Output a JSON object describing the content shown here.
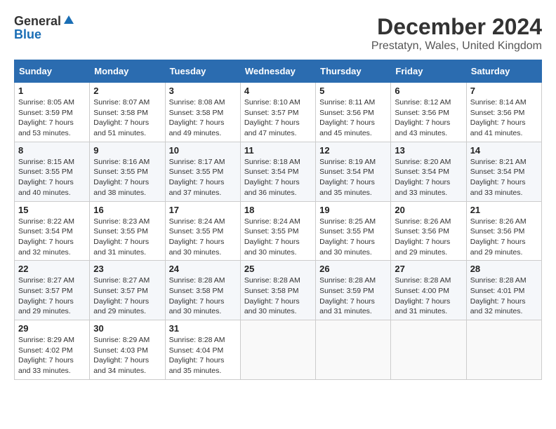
{
  "header": {
    "logo_general": "General",
    "logo_blue": "Blue",
    "month_title": "December 2024",
    "location": "Prestatyn, Wales, United Kingdom"
  },
  "days_of_week": [
    "Sunday",
    "Monday",
    "Tuesday",
    "Wednesday",
    "Thursday",
    "Friday",
    "Saturday"
  ],
  "weeks": [
    [
      {
        "day": "1",
        "sunrise": "8:05 AM",
        "sunset": "3:59 PM",
        "daylight": "7 hours and 53 minutes."
      },
      {
        "day": "2",
        "sunrise": "8:07 AM",
        "sunset": "3:58 PM",
        "daylight": "7 hours and 51 minutes."
      },
      {
        "day": "3",
        "sunrise": "8:08 AM",
        "sunset": "3:58 PM",
        "daylight": "7 hours and 49 minutes."
      },
      {
        "day": "4",
        "sunrise": "8:10 AM",
        "sunset": "3:57 PM",
        "daylight": "7 hours and 47 minutes."
      },
      {
        "day": "5",
        "sunrise": "8:11 AM",
        "sunset": "3:56 PM",
        "daylight": "7 hours and 45 minutes."
      },
      {
        "day": "6",
        "sunrise": "8:12 AM",
        "sunset": "3:56 PM",
        "daylight": "7 hours and 43 minutes."
      },
      {
        "day": "7",
        "sunrise": "8:14 AM",
        "sunset": "3:56 PM",
        "daylight": "7 hours and 41 minutes."
      }
    ],
    [
      {
        "day": "8",
        "sunrise": "8:15 AM",
        "sunset": "3:55 PM",
        "daylight": "7 hours and 40 minutes."
      },
      {
        "day": "9",
        "sunrise": "8:16 AM",
        "sunset": "3:55 PM",
        "daylight": "7 hours and 38 minutes."
      },
      {
        "day": "10",
        "sunrise": "8:17 AM",
        "sunset": "3:55 PM",
        "daylight": "7 hours and 37 minutes."
      },
      {
        "day": "11",
        "sunrise": "8:18 AM",
        "sunset": "3:54 PM",
        "daylight": "7 hours and 36 minutes."
      },
      {
        "day": "12",
        "sunrise": "8:19 AM",
        "sunset": "3:54 PM",
        "daylight": "7 hours and 35 minutes."
      },
      {
        "day": "13",
        "sunrise": "8:20 AM",
        "sunset": "3:54 PM",
        "daylight": "7 hours and 33 minutes."
      },
      {
        "day": "14",
        "sunrise": "8:21 AM",
        "sunset": "3:54 PM",
        "daylight": "7 hours and 33 minutes."
      }
    ],
    [
      {
        "day": "15",
        "sunrise": "8:22 AM",
        "sunset": "3:54 PM",
        "daylight": "7 hours and 32 minutes."
      },
      {
        "day": "16",
        "sunrise": "8:23 AM",
        "sunset": "3:55 PM",
        "daylight": "7 hours and 31 minutes."
      },
      {
        "day": "17",
        "sunrise": "8:24 AM",
        "sunset": "3:55 PM",
        "daylight": "7 hours and 30 minutes."
      },
      {
        "day": "18",
        "sunrise": "8:24 AM",
        "sunset": "3:55 PM",
        "daylight": "7 hours and 30 minutes."
      },
      {
        "day": "19",
        "sunrise": "8:25 AM",
        "sunset": "3:55 PM",
        "daylight": "7 hours and 30 minutes."
      },
      {
        "day": "20",
        "sunrise": "8:26 AM",
        "sunset": "3:56 PM",
        "daylight": "7 hours and 29 minutes."
      },
      {
        "day": "21",
        "sunrise": "8:26 AM",
        "sunset": "3:56 PM",
        "daylight": "7 hours and 29 minutes."
      }
    ],
    [
      {
        "day": "22",
        "sunrise": "8:27 AM",
        "sunset": "3:57 PM",
        "daylight": "7 hours and 29 minutes."
      },
      {
        "day": "23",
        "sunrise": "8:27 AM",
        "sunset": "3:57 PM",
        "daylight": "7 hours and 29 minutes."
      },
      {
        "day": "24",
        "sunrise": "8:28 AM",
        "sunset": "3:58 PM",
        "daylight": "7 hours and 30 minutes."
      },
      {
        "day": "25",
        "sunrise": "8:28 AM",
        "sunset": "3:58 PM",
        "daylight": "7 hours and 30 minutes."
      },
      {
        "day": "26",
        "sunrise": "8:28 AM",
        "sunset": "3:59 PM",
        "daylight": "7 hours and 31 minutes."
      },
      {
        "day": "27",
        "sunrise": "8:28 AM",
        "sunset": "4:00 PM",
        "daylight": "7 hours and 31 minutes."
      },
      {
        "day": "28",
        "sunrise": "8:28 AM",
        "sunset": "4:01 PM",
        "daylight": "7 hours and 32 minutes."
      }
    ],
    [
      {
        "day": "29",
        "sunrise": "8:29 AM",
        "sunset": "4:02 PM",
        "daylight": "7 hours and 33 minutes."
      },
      {
        "day": "30",
        "sunrise": "8:29 AM",
        "sunset": "4:03 PM",
        "daylight": "7 hours and 34 minutes."
      },
      {
        "day": "31",
        "sunrise": "8:28 AM",
        "sunset": "4:04 PM",
        "daylight": "7 hours and 35 minutes."
      },
      null,
      null,
      null,
      null
    ]
  ]
}
